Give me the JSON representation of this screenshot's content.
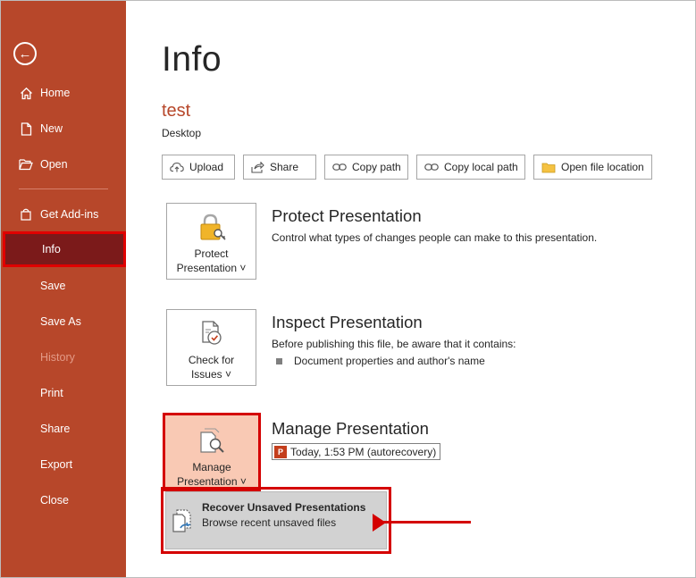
{
  "sidebar": {
    "back_icon": "back-arrow-icon",
    "items": [
      {
        "label": "Home",
        "icon": "home-icon"
      },
      {
        "label": "New",
        "icon": "new-document-icon"
      },
      {
        "label": "Open",
        "icon": "folder-open-icon"
      },
      {
        "label": "Get Add-ins",
        "icon": "store-icon"
      },
      {
        "label": "Info",
        "active": true
      },
      {
        "label": "Save"
      },
      {
        "label": "Save As"
      },
      {
        "label": "History",
        "disabled": true
      },
      {
        "label": "Print"
      },
      {
        "label": "Share"
      },
      {
        "label": "Export"
      },
      {
        "label": "Close"
      }
    ],
    "color": "#b7472a",
    "active_color": "#7b1a1a"
  },
  "main": {
    "title": "Info",
    "file_name": "test",
    "file_location": "Desktop",
    "toolbar": {
      "upload": "Upload",
      "share": "Share",
      "copy_path": "Copy path",
      "copy_local_path": "Copy local path",
      "open_file_location": "Open file location"
    },
    "protect": {
      "tile_line1": "Protect",
      "tile_line2": "Presentation ˅",
      "title": "Protect Presentation",
      "description": "Control what types of changes people can make to this presentation."
    },
    "inspect": {
      "tile_line1": "Check for",
      "tile_line2": "Issues ˅",
      "title": "Inspect Presentation",
      "description": "Before publishing this file, be aware that it contains:",
      "bullet": "Document properties and author's name"
    },
    "manage": {
      "tile_line1": "Manage",
      "tile_line2": "Presentation ˅",
      "title": "Manage Presentation",
      "version_label": "Today, 1:53 PM (autorecovery)",
      "version_icon": "P"
    },
    "recover_menu": {
      "title": "Recover Unsaved Presentations",
      "subtitle": "Browse recent unsaved files"
    }
  },
  "colors": {
    "accent": "#b7472a",
    "highlight_red": "#d40000"
  }
}
